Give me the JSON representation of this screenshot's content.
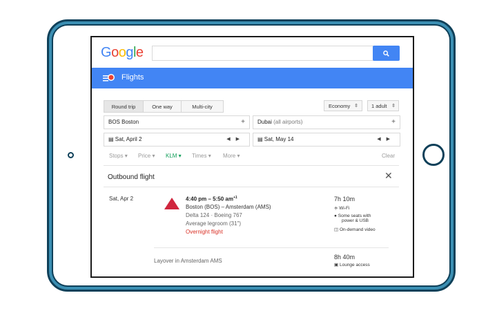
{
  "header": {
    "logo": [
      {
        "ch": "G",
        "color": "#4285f4"
      },
      {
        "ch": "o",
        "color": "#ea4335"
      },
      {
        "ch": "o",
        "color": "#fbbc05"
      },
      {
        "ch": "g",
        "color": "#4285f4"
      },
      {
        "ch": "l",
        "color": "#34a853"
      },
      {
        "ch": "e",
        "color": "#ea4335"
      }
    ],
    "search_value": ""
  },
  "app_bar": {
    "title": "Flights"
  },
  "trip_tabs": [
    "Round trip",
    "One way",
    "Multi-city"
  ],
  "cabin": "Economy",
  "passengers": "1 adult",
  "origin": {
    "code": "BOS",
    "city": "Boston"
  },
  "destination": {
    "city": "Dubai",
    "detail": "(all airports)"
  },
  "depart_date": "Sat, April 2",
  "return_date": "Sat, May 14",
  "filters": {
    "stops": "Stops",
    "price": "Price",
    "airline": "KLM",
    "times": "Times",
    "more": "More",
    "clear": "Clear"
  },
  "outbound": {
    "heading": "Outbound flight",
    "date": "Sat, Apr 2",
    "time_range": "4:40 pm – 5:50 am",
    "day_offset": "+1",
    "route": "Boston (BOS) – Amsterdam (AMS)",
    "flight": "Delta 124 · Boeing 767",
    "legroom": "Average legroom (31\")",
    "overnight": "Overnight flight",
    "duration": "7h 10m",
    "amenities": {
      "wifi": "Wi-Fi",
      "power_1": "Some seats with",
      "power_2": "power & USB",
      "video": "On-demand video"
    },
    "layover": "Layover in Amsterdam AMS",
    "layover_duration": "8h 40m",
    "lounge": "Lounge access"
  },
  "colors": {
    "accent": "#4285f4",
    "airline_red": "#d0263e",
    "overnight_red": "#d93025",
    "klm_green": "#0f9d58"
  }
}
